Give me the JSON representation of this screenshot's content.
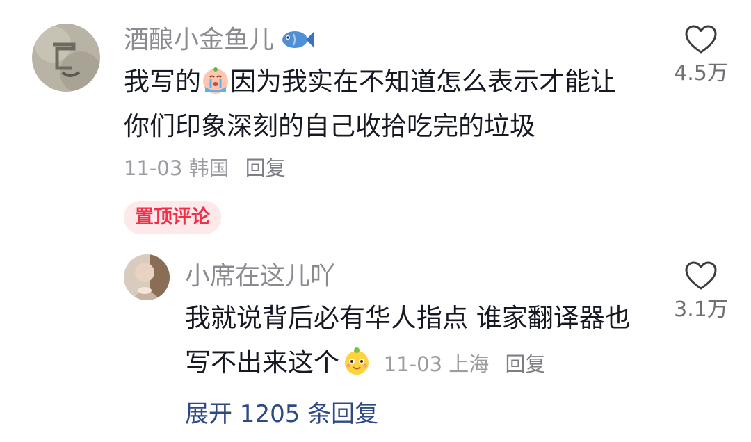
{
  "comments": [
    {
      "username": "酒酿小金鱼儿",
      "username_icon": "fish-icon",
      "text_parts": [
        "我写的",
        "因为我实在不知道怎么表示才能让你们印象深刻的自己收拾吃完的垃圾"
      ],
      "inline_emoji": "crying-face-icon",
      "date": "11-03",
      "location": "韩国",
      "reply_label": "回复",
      "likes": "4.5万",
      "badge": "置顶评论"
    },
    {
      "username": "小席在这儿吖",
      "text_parts": [
        "我就说背后必有华人指点 谁家翻译器也写不出来这个"
      ],
      "inline_emoji": "cute-face-icon",
      "date": "11-03",
      "location": "上海",
      "reply_label": "回复",
      "likes": "3.1万"
    }
  ],
  "expand_replies": "展开 1205 条回复",
  "colors": {
    "username": "#8a8b91",
    "text": "#161823",
    "meta": "#9b9ca1",
    "badge_bg": "#fde8ea",
    "badge_text": "#f0304a",
    "expand_link": "#2e4a86"
  }
}
